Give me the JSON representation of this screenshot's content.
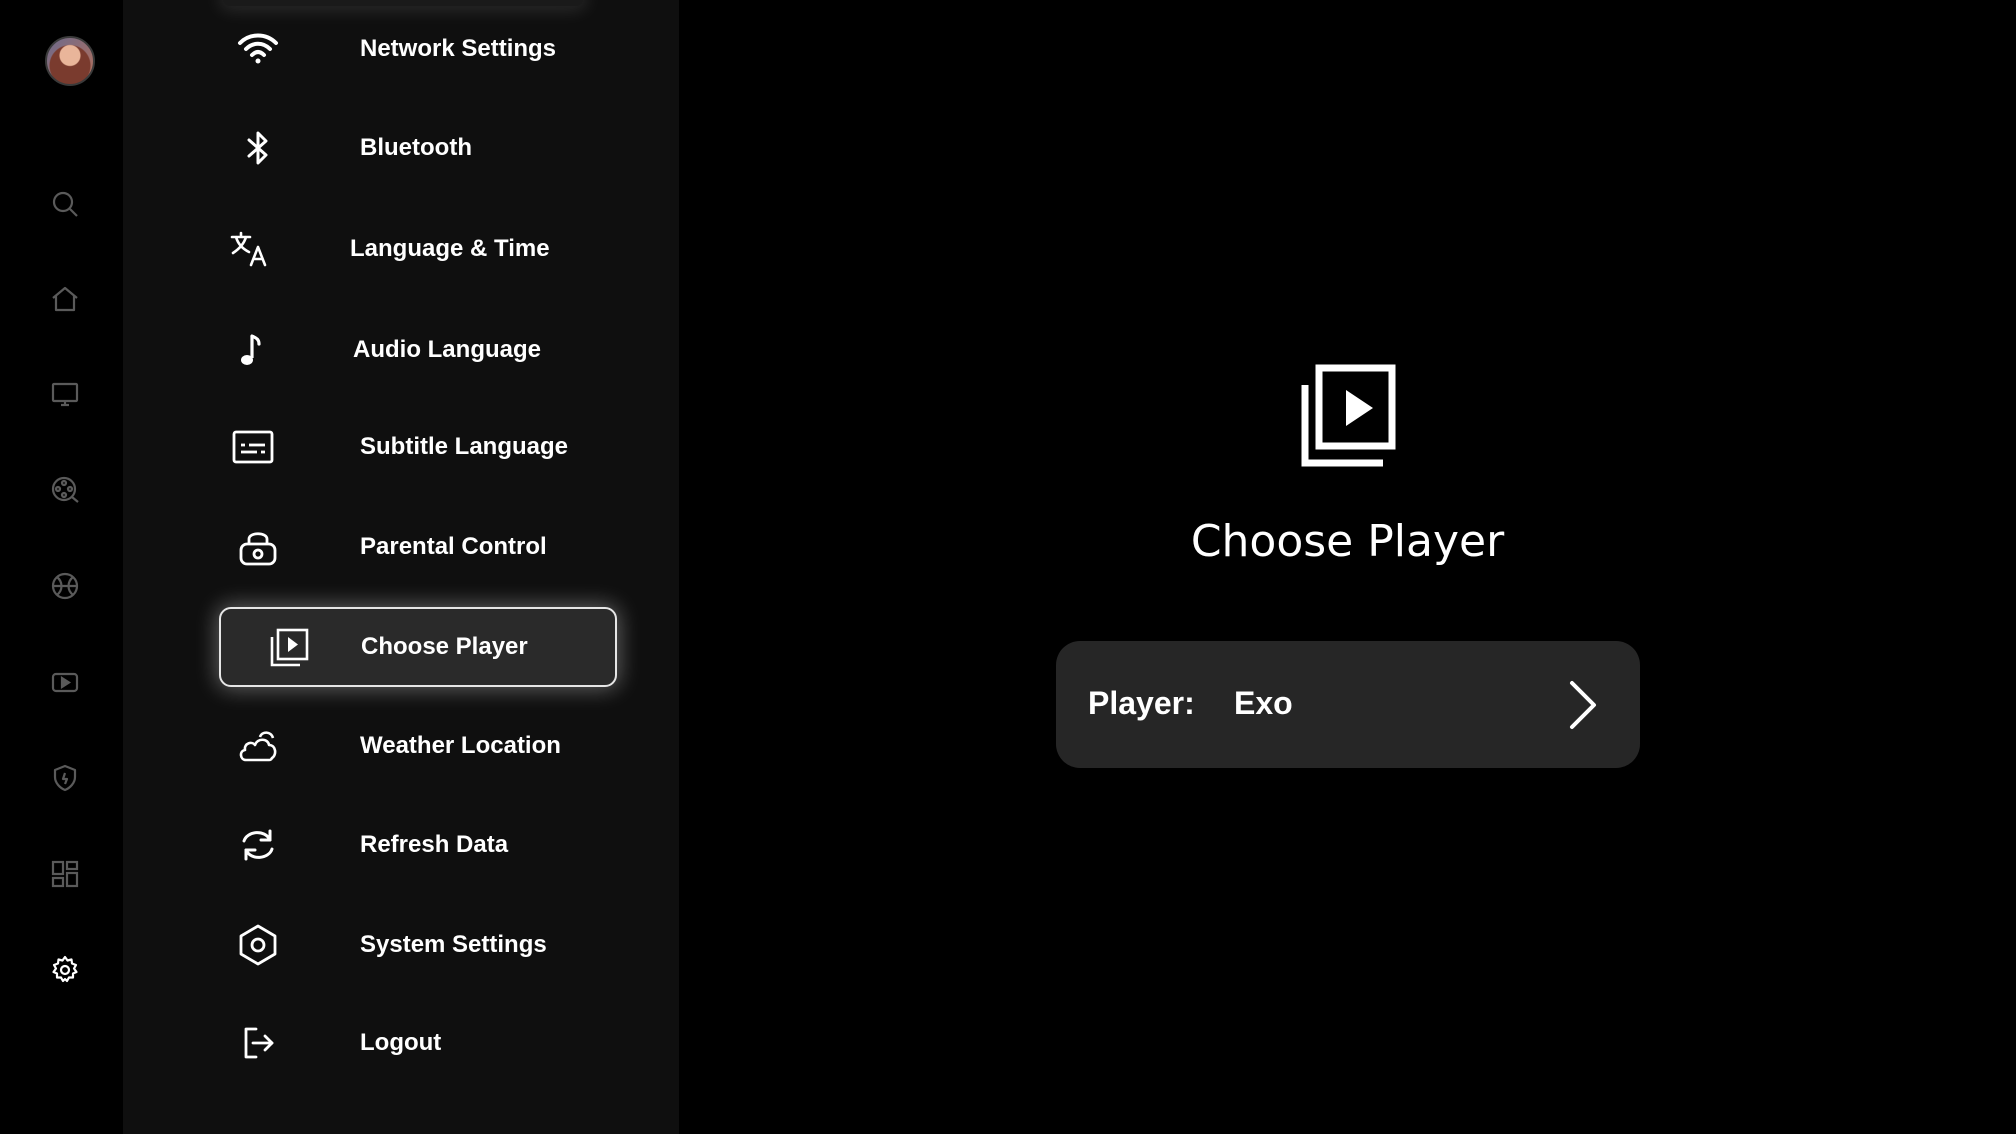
{
  "rail": {
    "icons": [
      "avatar",
      "search-icon",
      "home-icon",
      "tv-icon",
      "movie-reel-icon",
      "sports-ball-icon",
      "video-play-icon",
      "shield-icon",
      "grid-icon",
      "gear-icon"
    ]
  },
  "menu": {
    "items": [
      {
        "label": "Network Settings",
        "icon": "wifi-icon"
      },
      {
        "label": "Bluetooth",
        "icon": "bluetooth-icon"
      },
      {
        "label": "Language & Time",
        "icon": "translate-icon"
      },
      {
        "label": "Audio Language",
        "icon": "music-note-icon"
      },
      {
        "label": "Subtitle Language",
        "icon": "subtitles-icon"
      },
      {
        "label": "Parental Control",
        "icon": "lock-icon"
      },
      {
        "label": "Choose Player",
        "icon": "video-library-icon",
        "selected": true
      },
      {
        "label": "Weather Location",
        "icon": "cloud-icon"
      },
      {
        "label": "Refresh Data",
        "icon": "refresh-icon"
      },
      {
        "label": "System Settings",
        "icon": "hexagon-settings-icon"
      },
      {
        "label": "Logout",
        "icon": "logout-icon"
      }
    ]
  },
  "main": {
    "title": "Choose Player",
    "player_label": "Player:",
    "player_value": "Exo",
    "icon": "video-library-icon"
  },
  "colors": {
    "background": "#000000",
    "menu_background": "#0f0f0f",
    "card_background": "#262626",
    "selected_background": "#2a2a2a",
    "rail_icon": "#5a5a5a",
    "text": "#ffffff"
  }
}
